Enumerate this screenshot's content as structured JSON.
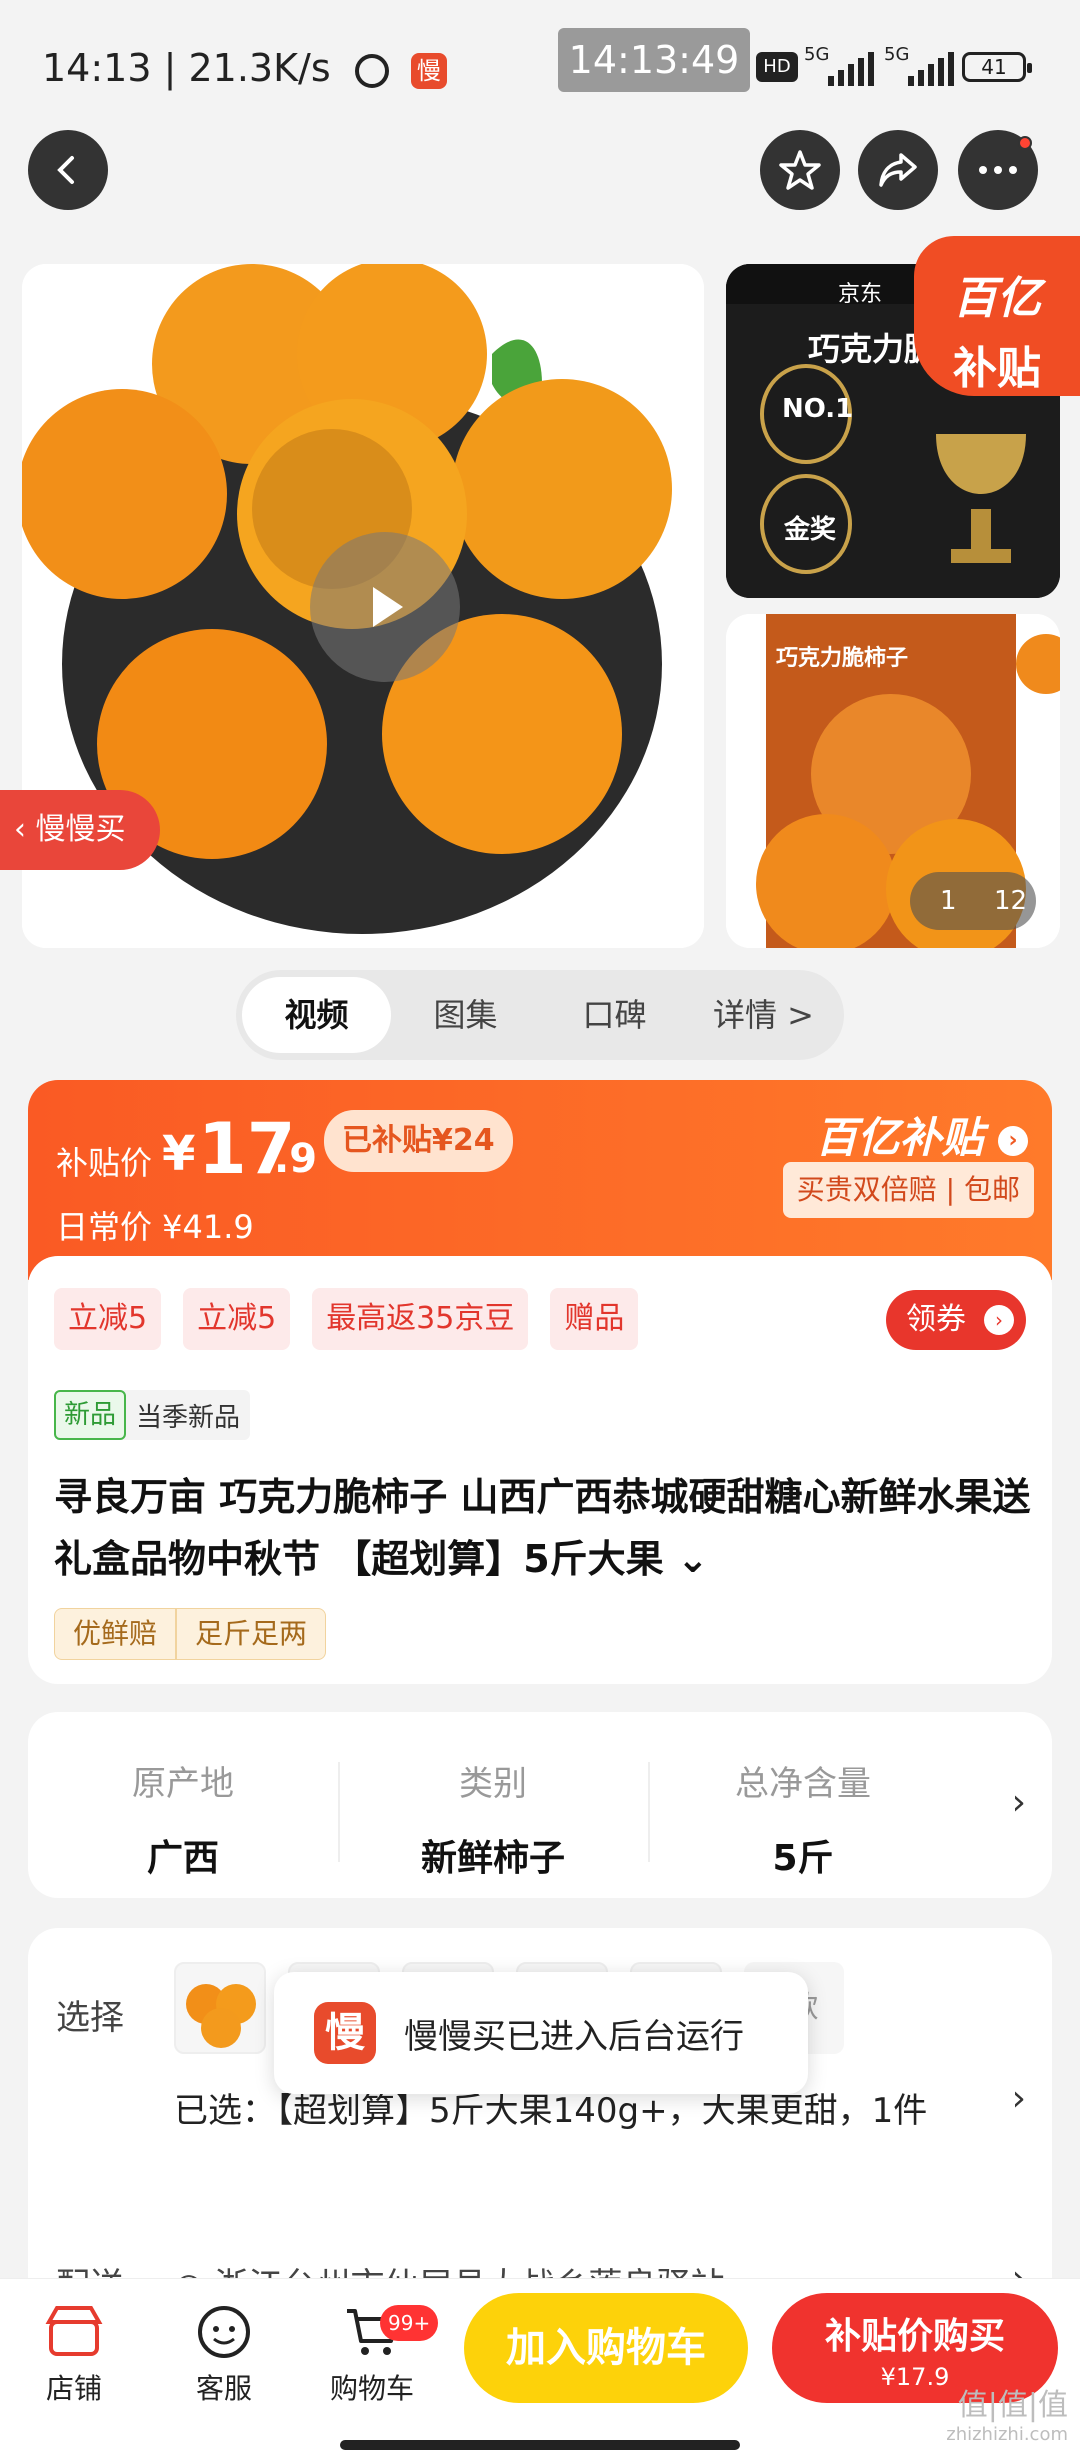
{
  "status_bar": {
    "time": "14:13",
    "net_speed": "21.3K/s",
    "app_badge": "慢",
    "screen_time": "14:13:49",
    "hd": "HD",
    "sig1": "5G",
    "sig2": "5G",
    "battery": "41"
  },
  "top_nav": {
    "back": "‹",
    "favorite": "☆",
    "share": "↗",
    "more": "···"
  },
  "media": {
    "subsidy_tag_l1": "百亿",
    "subsidy_tag_l2": "补贴",
    "thumb1_brand": "京东",
    "thumb1_title": "巧克力脆",
    "thumb1_no1": "NO.1",
    "thumb1_gold": "金奖",
    "thumb2_title": "巧克力脆柿子",
    "slowbuy_label": "慢慢买",
    "pager_current": "1",
    "pager_total": "12"
  },
  "tabs": [
    {
      "label": "视频"
    },
    {
      "label": "图集"
    },
    {
      "label": "口碑"
    },
    {
      "label": "详情 >"
    }
  ],
  "price": {
    "label": "补贴价",
    "yen": "¥",
    "integer": "17",
    "decimal": ".9",
    "subsidized": "已补贴¥24",
    "daily": "日常价 ¥41.9",
    "brand": "百亿补贴",
    "brand_arrow": "›",
    "guarantee": "买贵双倍赔 | 包邮"
  },
  "info": {
    "coupons": [
      "立减5",
      "立减5",
      "最高返35京豆",
      "赠品"
    ],
    "get_coupon": "领券",
    "get_coupon_arrow": "›",
    "new_badge": "新品",
    "new_text": "当季新品",
    "title": "寻良万亩 巧克力脆柿子 山西广西恭城硬甜糖心新鲜水果送礼盒品物中秋节 【超划算】5斤大果 ⌄",
    "guarantees": [
      "优鲜赔",
      "足斤足两"
    ]
  },
  "attributes": [
    {
      "key": "原产地",
      "value": "广西"
    },
    {
      "key": "类别",
      "value": "新鲜柿子"
    },
    {
      "key": "总净含量",
      "value": "5斤"
    }
  ],
  "attributes_arrow": "›",
  "selection": {
    "label": "选择",
    "count": "5款",
    "chosen": "已选：【超划算】5斤大果140g+，大果更甜，1件",
    "arrow": "›",
    "shipping_label": "配送",
    "shipping_value": "◎ 浙江台州市仙居县大战乡莲良驿站",
    "shipping_arrow": "›"
  },
  "toast": {
    "icon": "慢",
    "message": "慢慢买已进入后台运行"
  },
  "bottom_bar": {
    "store": "店铺",
    "service": "客服",
    "cart": "购物车",
    "cart_badge": "99+",
    "add_to_cart": "加入购物车",
    "buy_label": "补贴价购买",
    "buy_price": "¥17.9"
  },
  "watermark": {
    "main": "值|值|值",
    "sub": "zhizhizhi.com"
  },
  "colors": {
    "accent": "#f0332e",
    "orange": "#fa5a24",
    "yellow": "#fdd20a"
  }
}
